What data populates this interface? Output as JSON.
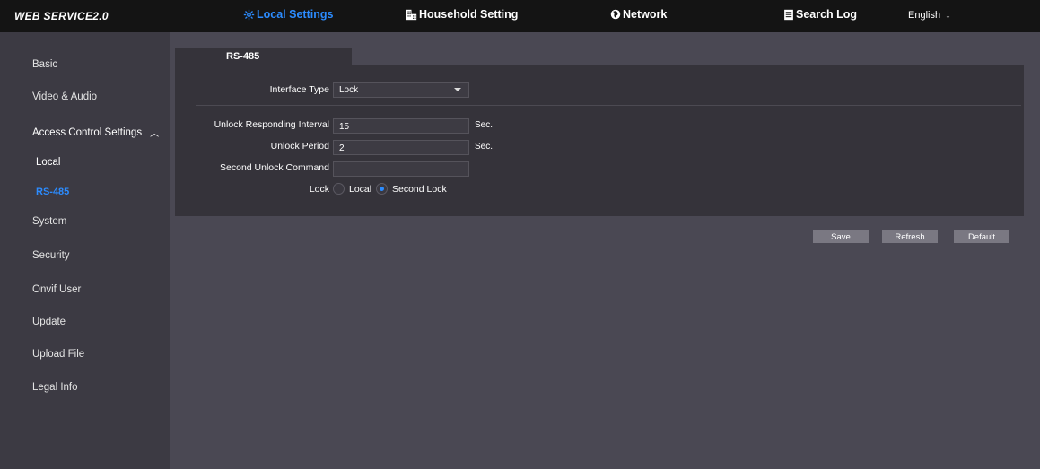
{
  "header": {
    "brand": "WEB SERVICE2.0",
    "nav": [
      {
        "label": "Local Settings",
        "icon": "gear-icon",
        "active": true
      },
      {
        "label": "Household Setting",
        "icon": "building-icon",
        "active": false
      },
      {
        "label": "Network",
        "icon": "globe-icon",
        "active": false
      },
      {
        "label": "Search Log",
        "icon": "document-icon",
        "active": false
      }
    ],
    "language": "English"
  },
  "sidebar": {
    "items": [
      {
        "label": "Basic"
      },
      {
        "label": "Video & Audio"
      },
      {
        "label": "Access Control Settings"
      },
      {
        "label": "Local"
      },
      {
        "label": "RS-485"
      },
      {
        "label": "System"
      },
      {
        "label": "Security"
      },
      {
        "label": "Onvif User"
      },
      {
        "label": "Update"
      },
      {
        "label": "Upload File"
      },
      {
        "label": "Legal Info"
      }
    ]
  },
  "tab": {
    "label": "RS-485"
  },
  "form": {
    "interface_type": {
      "label": "Interface Type",
      "value": "Lock"
    },
    "unlock_interval": {
      "label": "Unlock Responding Interval",
      "value": "15",
      "unit": "Sec."
    },
    "unlock_period": {
      "label": "Unlock Period",
      "value": "2",
      "unit": "Sec."
    },
    "second_unlock": {
      "label": "Second Unlock Command",
      "value": ""
    },
    "lock": {
      "label": "Lock",
      "options": [
        {
          "label": "Local",
          "selected": false
        },
        {
          "label": "Second Lock",
          "selected": true
        }
      ]
    }
  },
  "actions": {
    "save": "Save",
    "refresh": "Refresh",
    "default": "Default"
  },
  "colors": {
    "accent": "#2c8cff",
    "topbar": "#141414",
    "background": "#4a4853",
    "sidebar": "#3c3a43",
    "panel": "#35333a"
  }
}
